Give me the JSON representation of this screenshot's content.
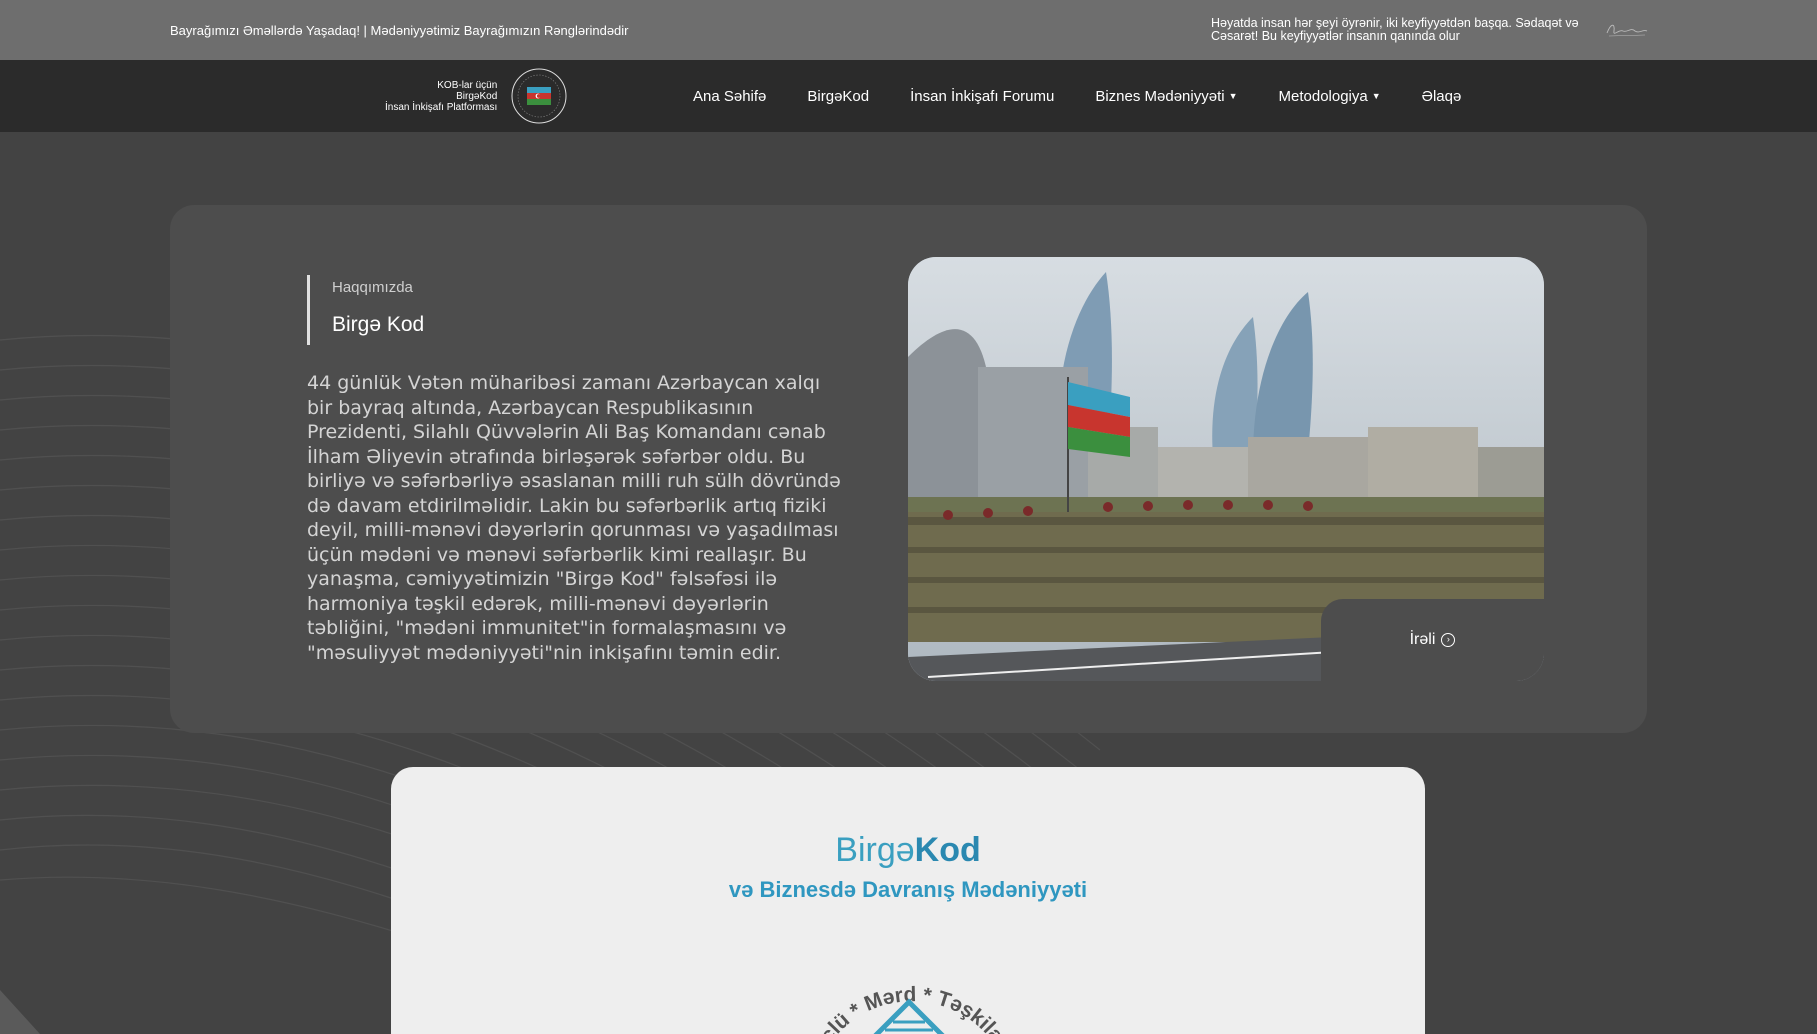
{
  "topbar": {
    "slogan": "Bayrağımızı Əməllərdə Yaşadaq! | Mədəniyyətimiz Bayrağımızın Rənglərindədir",
    "quote": "Həyatda insan hər şeyi öyrənir, iki keyfiyyətdən başqa. Sədaqət və Cəsarət! Bu keyfiyyətlər insanın qanında olur"
  },
  "brand": {
    "line1": "KOB-lar üçün",
    "line2": "BirgəKod",
    "line3": "İnsan İnkişafı Platforması"
  },
  "nav": {
    "items": [
      {
        "label": "Ana Səhifə"
      },
      {
        "label": "BirgəKod"
      },
      {
        "label": "İnsan İnkişafı Forumu"
      },
      {
        "label": "Biznes Mədəniyyəti"
      },
      {
        "label": "Metodologiya"
      },
      {
        "label": "Əlaqə"
      }
    ]
  },
  "about": {
    "eyebrow": "Haqqımızda",
    "title": "Birgə Kod",
    "body": "44 günlük Vətən müharibəsi zamanı Azərbaycan xalqı bir bayraq altında, Azərbaycan Respublikasının Prezidenti, Silahlı Qüvvələrin Ali Baş Komandanı cənab İlham Əliyevin ətrafında birləşərək səfərbər oldu. Bu birliyə və səfərbərliyə əsaslanan milli ruh sülh dövründə də davam etdirilməlidir. Lakin bu səfərbərlik artıq fiziki deyil, milli-mənəvi dəyərlərin qorunması və yaşadılması üçün mədəni və mənəvi səfərbərlik kimi reallaşır. Bu yanaşma, cəmiyyətimizin \"Birgə Kod\" fəlsəfəsi ilə harmoniya təşkil edərək, milli-mənəvi dəyərlərin təbliğini, \"mədəni immunitet\"in formalaşmasını və \"məsuliyyət mədəniyyəti\"nin inkişafını təmin edir.",
    "next_label": "İrəli"
  },
  "promo": {
    "brand_light": "Birgə",
    "brand_bold": "Kod",
    "subtitle": "və Biznesdə Davranış Mədəniyyəti",
    "seal_text": "Güclü * Mərd * Təşkilatlan"
  },
  "colors": {
    "topbar": "#6e6e6e",
    "nav": "#2b2b2b",
    "page": "#434343",
    "card": "#4d4d4d",
    "promo_accent": "#2f97c0"
  }
}
